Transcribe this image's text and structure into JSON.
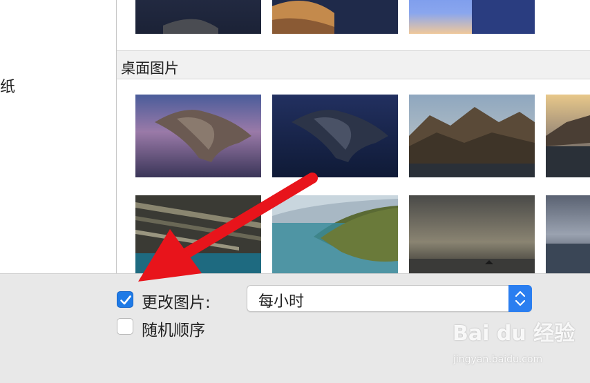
{
  "sidebar": {
    "label": "纸"
  },
  "section": {
    "title": "桌面图片"
  },
  "thumbnails": {
    "top_row": [
      "catalina-night",
      "mojave-dunes",
      "gradient-blue"
    ],
    "row1": [
      "catalina-island-dusk",
      "catalina-island-night",
      "catalina-mountains",
      "catalina-coast-partial"
    ],
    "row2": [
      "catalina-rock-strata",
      "catalina-green-coast",
      "catalina-sea-clouds",
      "catalina-sea-partial"
    ]
  },
  "options": {
    "change_picture_label": "更改图片:",
    "change_picture_checked": true,
    "random_order_label": "随机顺序",
    "random_order_checked": false,
    "interval_value": "每小时"
  },
  "watermark": {
    "text": "Bai du 经验",
    "subtext": "jingyan.baidu.com"
  },
  "annotation": {
    "arrow_color": "#e8141b"
  }
}
